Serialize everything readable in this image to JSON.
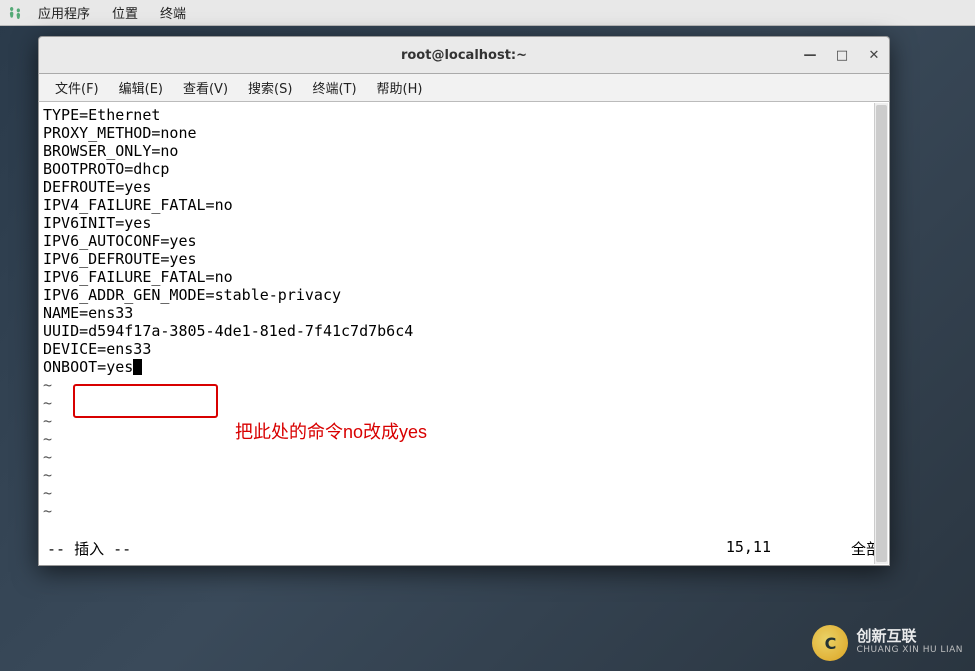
{
  "panel": {
    "items": [
      "应用程序",
      "位置",
      "终端"
    ]
  },
  "window": {
    "title": "root@localhost:~"
  },
  "menubar": {
    "items": [
      "文件(F)",
      "编辑(E)",
      "查看(V)",
      "搜索(S)",
      "终端(T)",
      "帮助(H)"
    ]
  },
  "config_lines": [
    "TYPE=Ethernet",
    "PROXY_METHOD=none",
    "BROWSER_ONLY=no",
    "BOOTPROTO=dhcp",
    "DEFROUTE=yes",
    "IPV4_FAILURE_FATAL=no",
    "IPV6INIT=yes",
    "IPV6_AUTOCONF=yes",
    "IPV6_DEFROUTE=yes",
    "IPV6_FAILURE_FATAL=no",
    "IPV6_ADDR_GEN_MODE=stable-privacy",
    "NAME=ens33",
    "UUID=d594f17a-3805-4de1-81ed-7f41c7d7b6c4",
    "DEVICE=ens33",
    "ONBOOT=yes"
  ],
  "status": {
    "mode": "-- 插入 --",
    "position": "15,11",
    "scroll": "全部"
  },
  "annotation": {
    "text": "把此处的命令no改成yes"
  },
  "watermark": {
    "cn": "创新互联",
    "en": "CHUANG XIN HU LIAN"
  },
  "icons": {
    "minimize": "—",
    "maximize": "□",
    "close": "✕"
  }
}
